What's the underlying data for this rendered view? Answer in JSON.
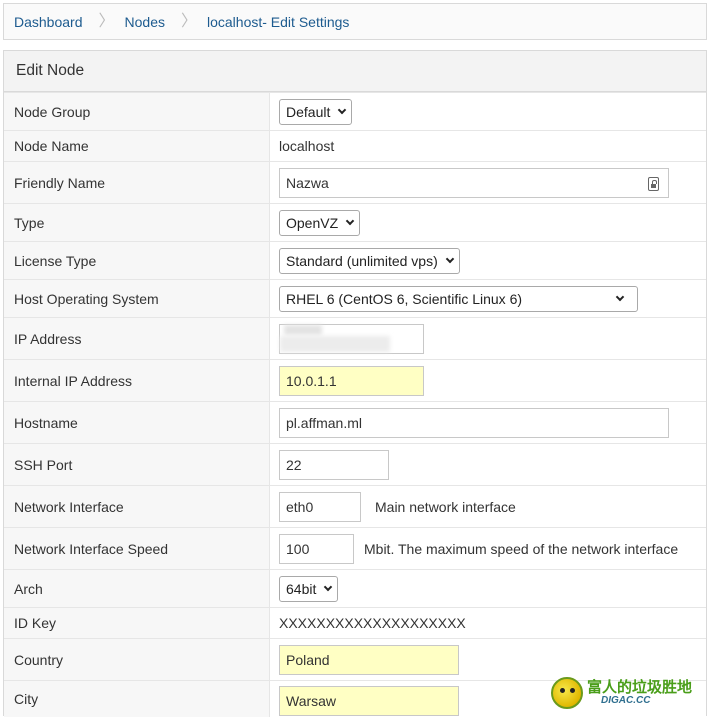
{
  "breadcrumb": [
    "Dashboard",
    "Nodes",
    "localhost- Edit Settings"
  ],
  "panel": {
    "title": "Edit Node"
  },
  "fields": {
    "node_group": {
      "label": "Node Group",
      "value": "Default"
    },
    "node_name": {
      "label": "Node Name",
      "value": "localhost"
    },
    "friendly_name": {
      "label": "Friendly Name",
      "value": "Nazwa"
    },
    "type": {
      "label": "Type",
      "value": "OpenVZ"
    },
    "license_type": {
      "label": "License Type",
      "value": "Standard (unlimited vps)"
    },
    "host_os": {
      "label": "Host Operating System",
      "value": "RHEL 6 (CentOS 6, Scientific Linux 6)"
    },
    "ip_address": {
      "label": "IP Address",
      "value": ""
    },
    "internal_ip": {
      "label": "Internal IP Address",
      "value": "10.0.1.1"
    },
    "hostname": {
      "label": "Hostname",
      "value": "pl.affman.ml"
    },
    "ssh_port": {
      "label": "SSH Port",
      "value": "22"
    },
    "net_iface": {
      "label": "Network Interface",
      "value": "eth0",
      "hint": "Main network interface"
    },
    "net_speed": {
      "label": "Network Interface Speed",
      "value": "100",
      "hint": "Mbit. The maximum speed of the network interface"
    },
    "arch": {
      "label": "Arch",
      "value": "64bit"
    },
    "id_key": {
      "label": "ID Key",
      "value": "XXXXXXXXXXXXXXXXXXXX"
    },
    "country": {
      "label": "Country",
      "value": "Poland"
    },
    "city": {
      "label": "City",
      "value": "Warsaw"
    }
  },
  "icons": {
    "password_reveal": "password-manager-icon",
    "dropdown": "chevron-down-icon"
  },
  "watermark": {
    "cn": "富人的垃圾胜地",
    "en": "DIGAC.CC"
  },
  "colors": {
    "link": "#1d5b8f",
    "highlight_input": "#ffffc4",
    "label_bg": "#f7f7f7"
  }
}
